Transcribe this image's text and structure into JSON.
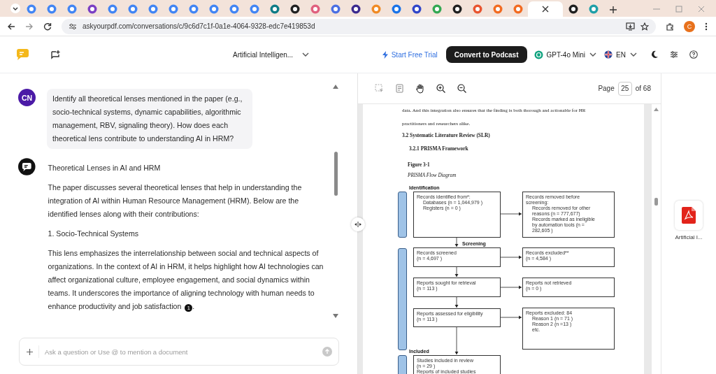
{
  "browser": {
    "tabs": [
      {
        "color": "#4285f4",
        "selected": false
      },
      {
        "color": "#4285f4",
        "selected": false
      },
      {
        "color": "#4285f4",
        "selected": false
      },
      {
        "color": "#7b3fc4",
        "selected": false
      },
      {
        "color": "#4285f4",
        "selected": false
      },
      {
        "color": "#4285f4",
        "selected": false
      },
      {
        "color": "#4285f4",
        "selected": false
      },
      {
        "color": "#4285f4",
        "selected": false
      },
      {
        "color": "#4285f4",
        "selected": false
      },
      {
        "color": "#4285f4",
        "selected": false
      },
      {
        "color": "#4285f4",
        "selected": false
      },
      {
        "color": "#4285f4",
        "selected": false
      },
      {
        "color": "#0e7c86",
        "selected": false
      },
      {
        "color": "#222222",
        "selected": false
      },
      {
        "color": "#e0607e",
        "selected": false
      },
      {
        "color": "#4a6fe3",
        "selected": false
      },
      {
        "color": "#3b2a8f",
        "selected": false
      },
      {
        "color": "#f08a24",
        "selected": false
      },
      {
        "color": "#1a73e8",
        "selected": false
      },
      {
        "color": "#3046c9",
        "selected": false
      },
      {
        "color": "#34a853",
        "selected": false
      },
      {
        "color": "#202020",
        "selected": false
      },
      {
        "color": "#e8542f",
        "selected": false
      },
      {
        "color": "#f26b21",
        "selected": false
      },
      {
        "color": "#f26b21",
        "selected": false
      },
      {
        "selected": true
      },
      {
        "color": "#202020",
        "selected": false
      },
      {
        "color": "#1f9fa8",
        "selected": false
      }
    ],
    "url": "askyourpdf.com/conversations/c/9c6d7c1f-0a1e-4064-9328-edc7e419853d",
    "profile_initial": "C"
  },
  "header": {
    "document_title": "Artificial Intelligen...",
    "trial_link": "Start Free Trial",
    "podcast_button": "Convert to Podcast",
    "model": "GPT-4o Mini",
    "language": "EN"
  },
  "chat": {
    "messages": [
      {
        "kind": "user",
        "avatar": "CN",
        "text": "Identify all theoretical lenses mentioned in the paper (e.g., socio-technical systems, dynamic capabilities, algorithmic management, RBV, signaling theory). How does each theoretical lens contribute to understanding AI in HRM?"
      },
      {
        "kind": "assistant",
        "blocks": [
          {
            "kind": "title",
            "text": "Theoretical Lenses in AI and HRM"
          },
          {
            "kind": "paragraph",
            "text": "The paper discusses several theoretical lenses that help in understanding the integration of AI within Human Resource Management (HRM). Below are the identified lenses along with their contributions:"
          },
          {
            "kind": "title",
            "text": "1. Socio-Technical Systems"
          },
          {
            "kind": "paragraph",
            "text": "This lens emphasizes the interrelationship between social and technical aspects of organizations. In the context of AI in HRM, it helps highlight how AI technologies can affect organizational culture, employee engagement, and social dynamics within teams. It underscores the importance of aligning technology with human needs to enhance productivity and job satisfaction",
            "citation": "1",
            "tail": "."
          }
        ]
      }
    ],
    "input": {
      "placeholder": "Ask a question or Use @ to mention a document"
    }
  },
  "pdf": {
    "page_label": "Page",
    "page": "25",
    "page_total": "of 68",
    "lines": [
      {
        "kind": "body",
        "text": "data. And this integration also ensures that the finding is both thorough and actionable for HR"
      },
      {
        "kind": "body",
        "text": "practitioners and researchers alike."
      },
      {
        "kind": "heading",
        "text": "3.2 Systematic Literature Review (SLR)"
      },
      {
        "kind": "subheading",
        "text": "3.2.1 PRISMA Framework"
      },
      {
        "kind": "figure_label",
        "text": "Figure 3-1"
      },
      {
        "kind": "caption",
        "text": "PRISMA Flow Diagram"
      }
    ],
    "figure": {
      "stages": [
        {
          "label": "Identification"
        },
        {
          "label": "Screening"
        },
        {
          "label": "Included"
        }
      ],
      "boxes": [
        {
          "lines": [
            {
              "text": "Records identified from*:",
              "indent": false
            },
            {
              "text": "Databases (n = 1,044,979 )",
              "indent": true
            },
            {
              "text": "Registers (n = 0 )",
              "indent": true
            }
          ]
        },
        {
          "lines": [
            {
              "text": "Records removed before",
              "indent": false
            },
            {
              "text": "screening:",
              "indent": false
            },
            {
              "text": "Records removed for other",
              "indent": true
            },
            {
              "text": "reasons (n = 777,677)",
              "indent": true
            },
            {
              "text": "Records marked as ineligible",
              "indent": true
            },
            {
              "text": "by automation tools (n =",
              "indent": true
            },
            {
              "text": "282,605 )",
              "indent": true
            }
          ]
        },
        {
          "lines": [
            {
              "text": "Records screened",
              "indent": false
            },
            {
              "text": "(n = 4,697 )",
              "indent": false
            }
          ]
        },
        {
          "lines": [
            {
              "text": "Records excluded**",
              "indent": false
            },
            {
              "text": "(n = 4,584 )",
              "indent": false
            }
          ]
        },
        {
          "lines": [
            {
              "text": "Reports sought for retrieval",
              "indent": false
            },
            {
              "text": "(n = 113 )",
              "indent": false
            }
          ]
        },
        {
          "lines": [
            {
              "text": "Reports not retrieved",
              "indent": false
            },
            {
              "text": "(n = 0 )",
              "indent": false
            }
          ]
        },
        {
          "lines": [
            {
              "text": "Reports assessed for eligibility",
              "indent": false
            },
            {
              "text": "(n = 113 )",
              "indent": false
            }
          ]
        },
        {
          "lines": [
            {
              "text": "Reports excluded: 84",
              "indent": false
            },
            {
              "text": "Reason 1 (n = 71 )",
              "indent": true
            },
            {
              "text": "Reason 2 (n =13 )",
              "indent": true
            },
            {
              "text": "etc.",
              "indent": true
            }
          ]
        },
        {
          "lines": [
            {
              "text": "Studies included in review",
              "indent": false
            },
            {
              "text": "(n = 29 )",
              "indent": false
            },
            {
              "text": "Reports of included studies",
              "indent": false
            }
          ]
        }
      ]
    }
  },
  "files": [
    {
      "name": "Artificial I..."
    }
  ]
}
